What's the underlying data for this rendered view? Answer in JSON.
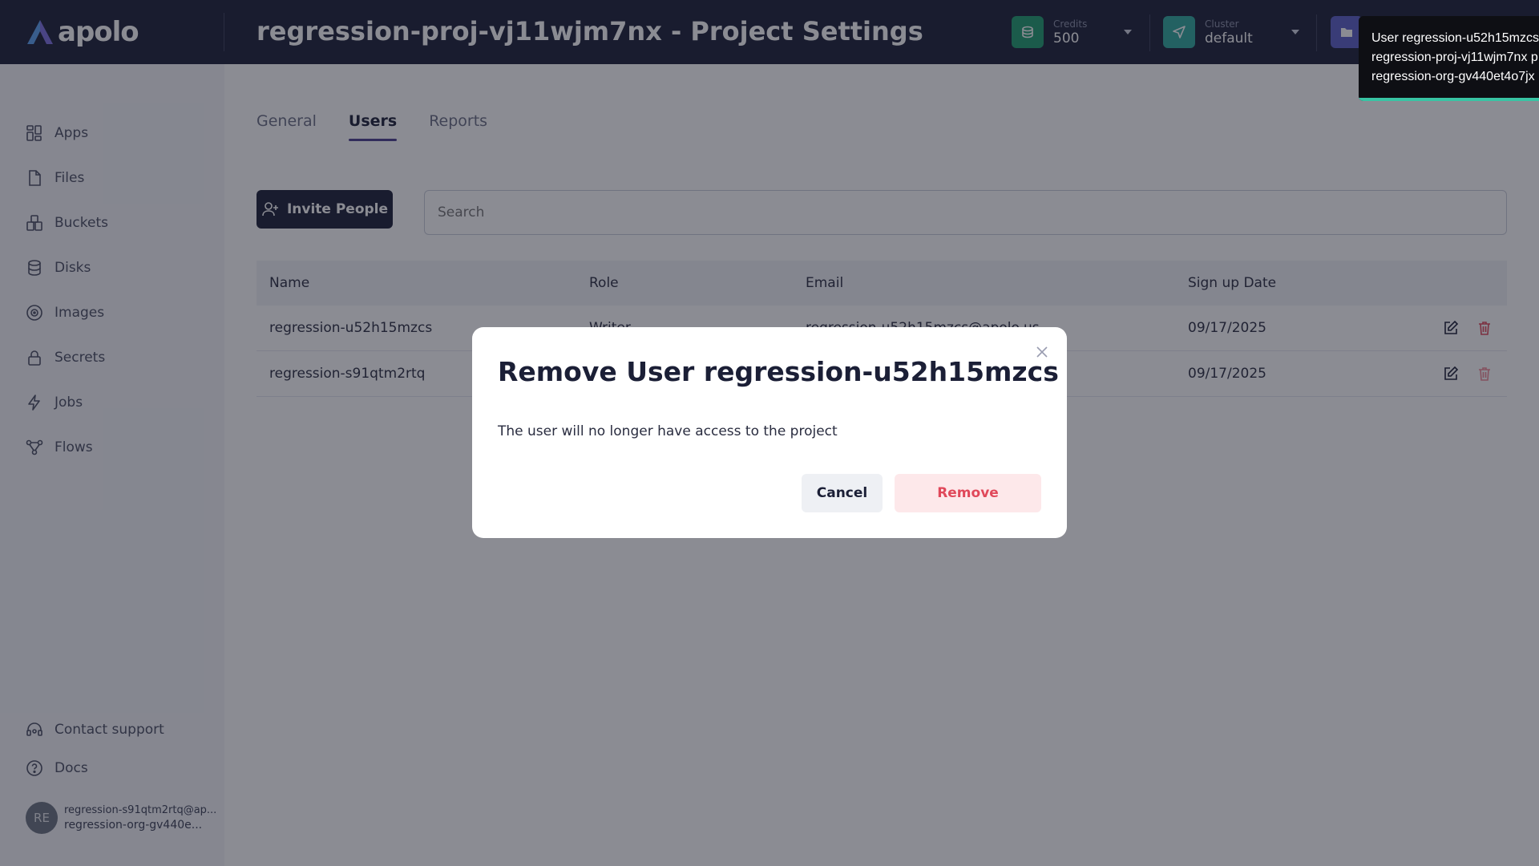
{
  "header": {
    "logo_text": "apolo",
    "page_title": "regression-proj-vj11wjm7nx - Project Settings",
    "credits": {
      "label": "Credits",
      "value": "500"
    },
    "cluster": {
      "label": "Cluster",
      "value": "default"
    }
  },
  "sidebar": {
    "items": [
      {
        "label": "Apps",
        "icon": "grid-icon"
      },
      {
        "label": "Files",
        "icon": "file-icon"
      },
      {
        "label": "Buckets",
        "icon": "bucket-icon"
      },
      {
        "label": "Disks",
        "icon": "database-icon"
      },
      {
        "label": "Images",
        "icon": "disc-icon"
      },
      {
        "label": "Secrets",
        "icon": "lock-icon"
      },
      {
        "label": "Jobs",
        "icon": "bolt-icon"
      },
      {
        "label": "Flows",
        "icon": "flow-icon"
      }
    ],
    "footer": [
      {
        "label": "Contact support",
        "icon": "headset-icon"
      },
      {
        "label": "Docs",
        "icon": "help-icon"
      }
    ],
    "user": {
      "initials": "RE",
      "email": "regression-s91qtm2rtq@ap...",
      "org": "regression-org-gv440e..."
    }
  },
  "tabs": [
    {
      "label": "General",
      "active": false
    },
    {
      "label": "Users",
      "active": true
    },
    {
      "label": "Reports",
      "active": false
    }
  ],
  "invite_button": "Invite People",
  "search": {
    "placeholder": "Search",
    "value": ""
  },
  "table": {
    "columns": [
      "Name",
      "Role",
      "Email",
      "Sign up Date"
    ],
    "rows": [
      {
        "name": "regression-u52h15mzcs",
        "role": "Writer",
        "email": "regression-u52h15mzcs@apolo.us",
        "date": "09/17/2025"
      },
      {
        "name": "regression-s91qtm2rtq",
        "role": "",
        "email": "",
        "date": "09/17/2025"
      }
    ]
  },
  "modal": {
    "title": "Remove User regression-u52h15mzcs",
    "body": "The user will no longer have access to the project",
    "cancel_label": "Cancel",
    "remove_label": "Remove"
  },
  "toast": {
    "lines": [
      "User regression-u52h15mzcs",
      "regression-proj-vj11wjm7nx p",
      "regression-org-gv440et4o7jx"
    ]
  },
  "colors": {
    "header_bg": "#1b1f36",
    "accent": "#4b3f8f",
    "danger": "#e0485a",
    "credits_icon_bg": "#1f9d6e",
    "cluster_icon_bg": "#2fa89c",
    "project_icon_bg": "#5b5fc7",
    "toast_progress": "#38c4a4"
  }
}
